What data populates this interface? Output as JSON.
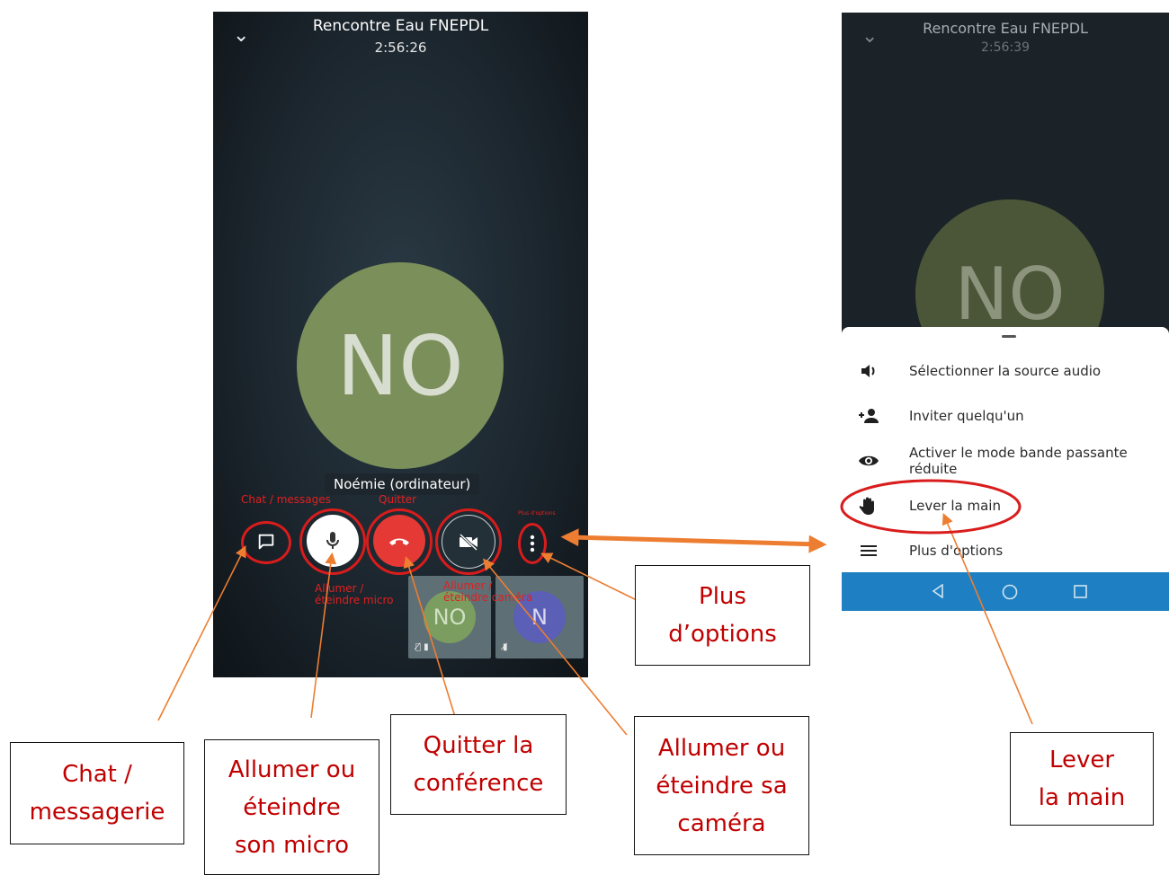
{
  "meeting": {
    "title": "Rencontre Eau FNEPDL",
    "time_left": "2:56:26",
    "time_right": "2:56:39",
    "avatar_initials": "NO",
    "participant_name": "Noémie (ordinateur)",
    "thumbnails": [
      {
        "initials": "NO",
        "color": "#7b9d5f"
      },
      {
        "initials": "N",
        "color": "#5b5fb5"
      }
    ]
  },
  "overlay_labels": {
    "chat": "Chat / messages",
    "quit": "Quitter",
    "more": "Plus d'options",
    "mic_1": "Allumer /",
    "mic_2": "éteindre micro",
    "cam_1": "Allumer /",
    "cam_2": "éteindre caméra"
  },
  "menu": {
    "items": [
      {
        "label": "Sélectionner la source audio",
        "icon": "speaker-icon"
      },
      {
        "label": "Inviter quelqu'un",
        "icon": "add-person-icon"
      },
      {
        "label": "Activer le mode bande passante réduite",
        "icon": "eye-icon"
      },
      {
        "label": "Lever la main",
        "icon": "hand-icon"
      },
      {
        "label": "Plus d'options",
        "icon": "menu-lines-icon"
      }
    ]
  },
  "annotations": {
    "chat": [
      "Chat /",
      "messagerie"
    ],
    "mic": [
      "Allumer ou",
      "éteindre",
      "son micro"
    ],
    "quit": [
      "Quitter la",
      "conférence"
    ],
    "camera": [
      "Allumer ou",
      "éteindre sa",
      "caméra"
    ],
    "more": [
      "Plus",
      "d’options"
    ],
    "hand": [
      "Lever",
      "la main"
    ]
  },
  "colors": {
    "accent_red": "#d91c1c",
    "annotation_text": "#c00000",
    "arrow_orange": "#ed7d31",
    "navbar_blue": "#1e80c2"
  }
}
